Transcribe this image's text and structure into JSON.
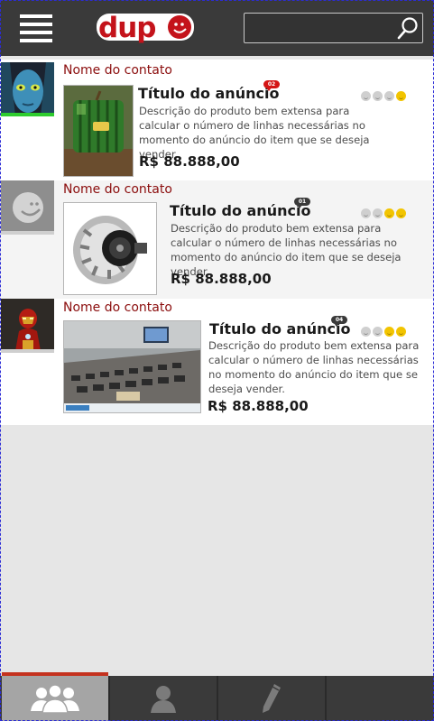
{
  "app": {
    "logo_text": "dupo",
    "search": {
      "value": "",
      "placeholder": ""
    }
  },
  "colors": {
    "header": "#3a3a3a",
    "brand_red": "#c4131b",
    "contact_name": "#8b0d0d",
    "tab_indicator": "#c4311e",
    "rating_on": "#f2c400",
    "rating_off": "#cfcfcf"
  },
  "listings": [
    {
      "contact_name": "Nome do contato",
      "avatar": "avatar-blue-alien",
      "title": "Título do anúncio",
      "badge": "02",
      "badge_color": "red",
      "rating": 1,
      "rating_max": 4,
      "description": "Descrição do produto bem extensa para calcular o número de linhas necessárias no momento do anúncio do item que se deseja vender.",
      "price": "R$ 88.888,00",
      "image": "square-watermelon"
    },
    {
      "contact_name": "Nome do contato",
      "avatar": "avatar-placeholder-smiley",
      "title": "Título do anúncio",
      "badge": "01",
      "badge_color": "dark",
      "rating": 2,
      "rating_max": 4,
      "description": "Descrição do produto bem extensa para calcular o número de linhas necessárias no momento do anúncio do item que se deseja vender.",
      "price": "R$ 88.888,00",
      "image": "car-alternator"
    },
    {
      "contact_name": "Nome do contato",
      "avatar": "avatar-iron-man",
      "title": "Título do anúncio",
      "badge": "04",
      "badge_color": "dark",
      "rating": 2,
      "rating_max": 4,
      "description": "Descrição do produto bem extensa para calcular o número de linhas necessárias no momento do anúncio do item que se deseja vender.",
      "price": "R$ 88.888,00",
      "image": "phone-collection-table"
    }
  ],
  "tabs": [
    {
      "icon": "contacts-group-icon",
      "active": true
    },
    {
      "icon": "user-profile-icon",
      "active": false
    },
    {
      "icon": "pencil-edit-icon",
      "active": false
    },
    {
      "icon": "",
      "active": false
    }
  ]
}
